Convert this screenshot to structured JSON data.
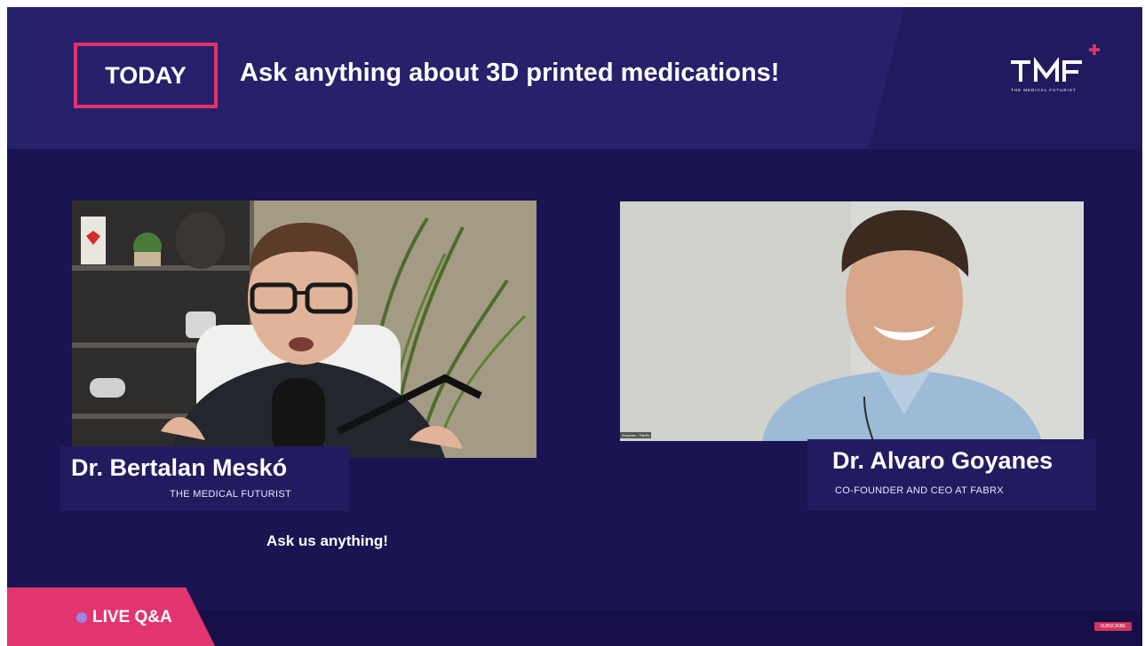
{
  "banner": {
    "today_label": "TODAY",
    "headline": "Ask anything about 3D printed medications!"
  },
  "logo": {
    "mark": "TMF",
    "tagline": "THE MEDICAL FUTURIST",
    "accent": "#e0336b"
  },
  "hosts": [
    {
      "name": "Dr. Bertalan Meskó",
      "role": "THE MEDICAL FUTURIST"
    },
    {
      "name": "Dr. Alvaro Goyanes",
      "role": "CO-FOUNDER AND CEO AT FABRX"
    }
  ],
  "video_right_tag": "Goyanes - FabRx",
  "cta": "Ask us anything!",
  "live": {
    "label": "LIVE Q&A"
  },
  "subscribe_label": "SUBSCRIBE",
  "colors": {
    "background": "#1a1452",
    "banner": "#27206a",
    "accent": "#e2356e",
    "name_plate": "#231b60"
  }
}
